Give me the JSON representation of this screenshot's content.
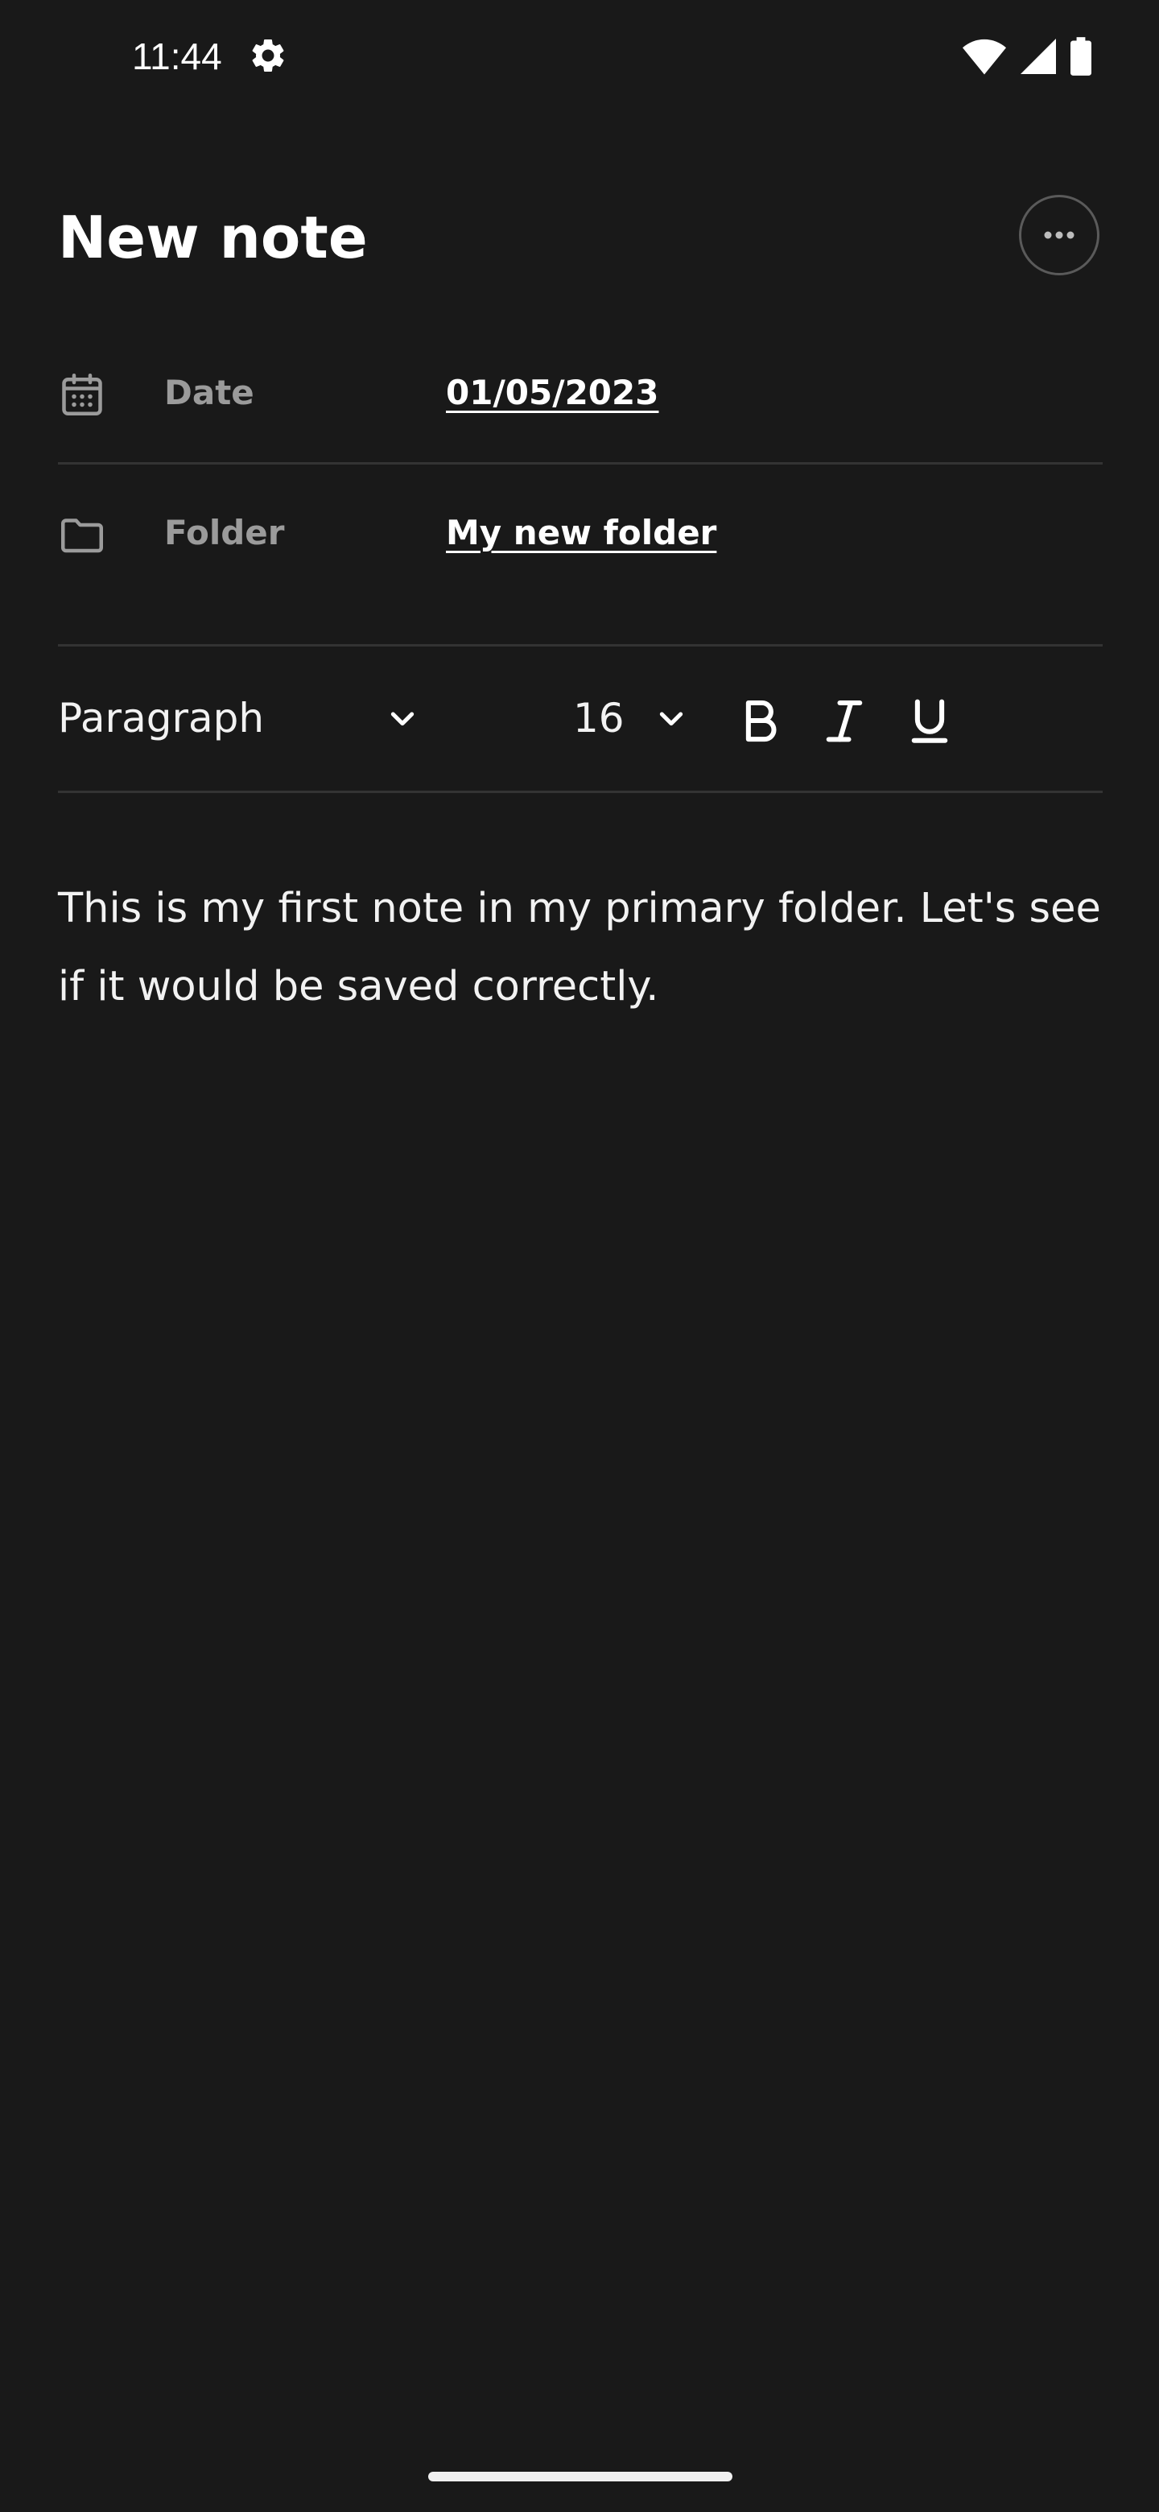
{
  "status_bar": {
    "time": "11:44",
    "icons": [
      "settings-gear-icon",
      "wifi-icon",
      "cell-signal-icon",
      "battery-icon"
    ]
  },
  "header": {
    "title": "New note",
    "more_icon": "more-horizontal-icon"
  },
  "meta": {
    "date": {
      "icon": "calendar-icon",
      "label": "Date",
      "value": "01/05/2023"
    },
    "folder": {
      "icon": "folder-icon",
      "label": "Folder",
      "value": "My new folder"
    }
  },
  "toolbar": {
    "block_type": "Paragraph",
    "font_size": "16",
    "format_buttons": [
      "bold-icon",
      "italic-icon",
      "underline-icon"
    ]
  },
  "note": {
    "body": "This is my first note in my primary folder. Let's see if it would be saved correctly."
  },
  "colors": {
    "background": "#191919",
    "text": "#ffffff",
    "label": "#9b9b9b",
    "divider": "#333333"
  }
}
